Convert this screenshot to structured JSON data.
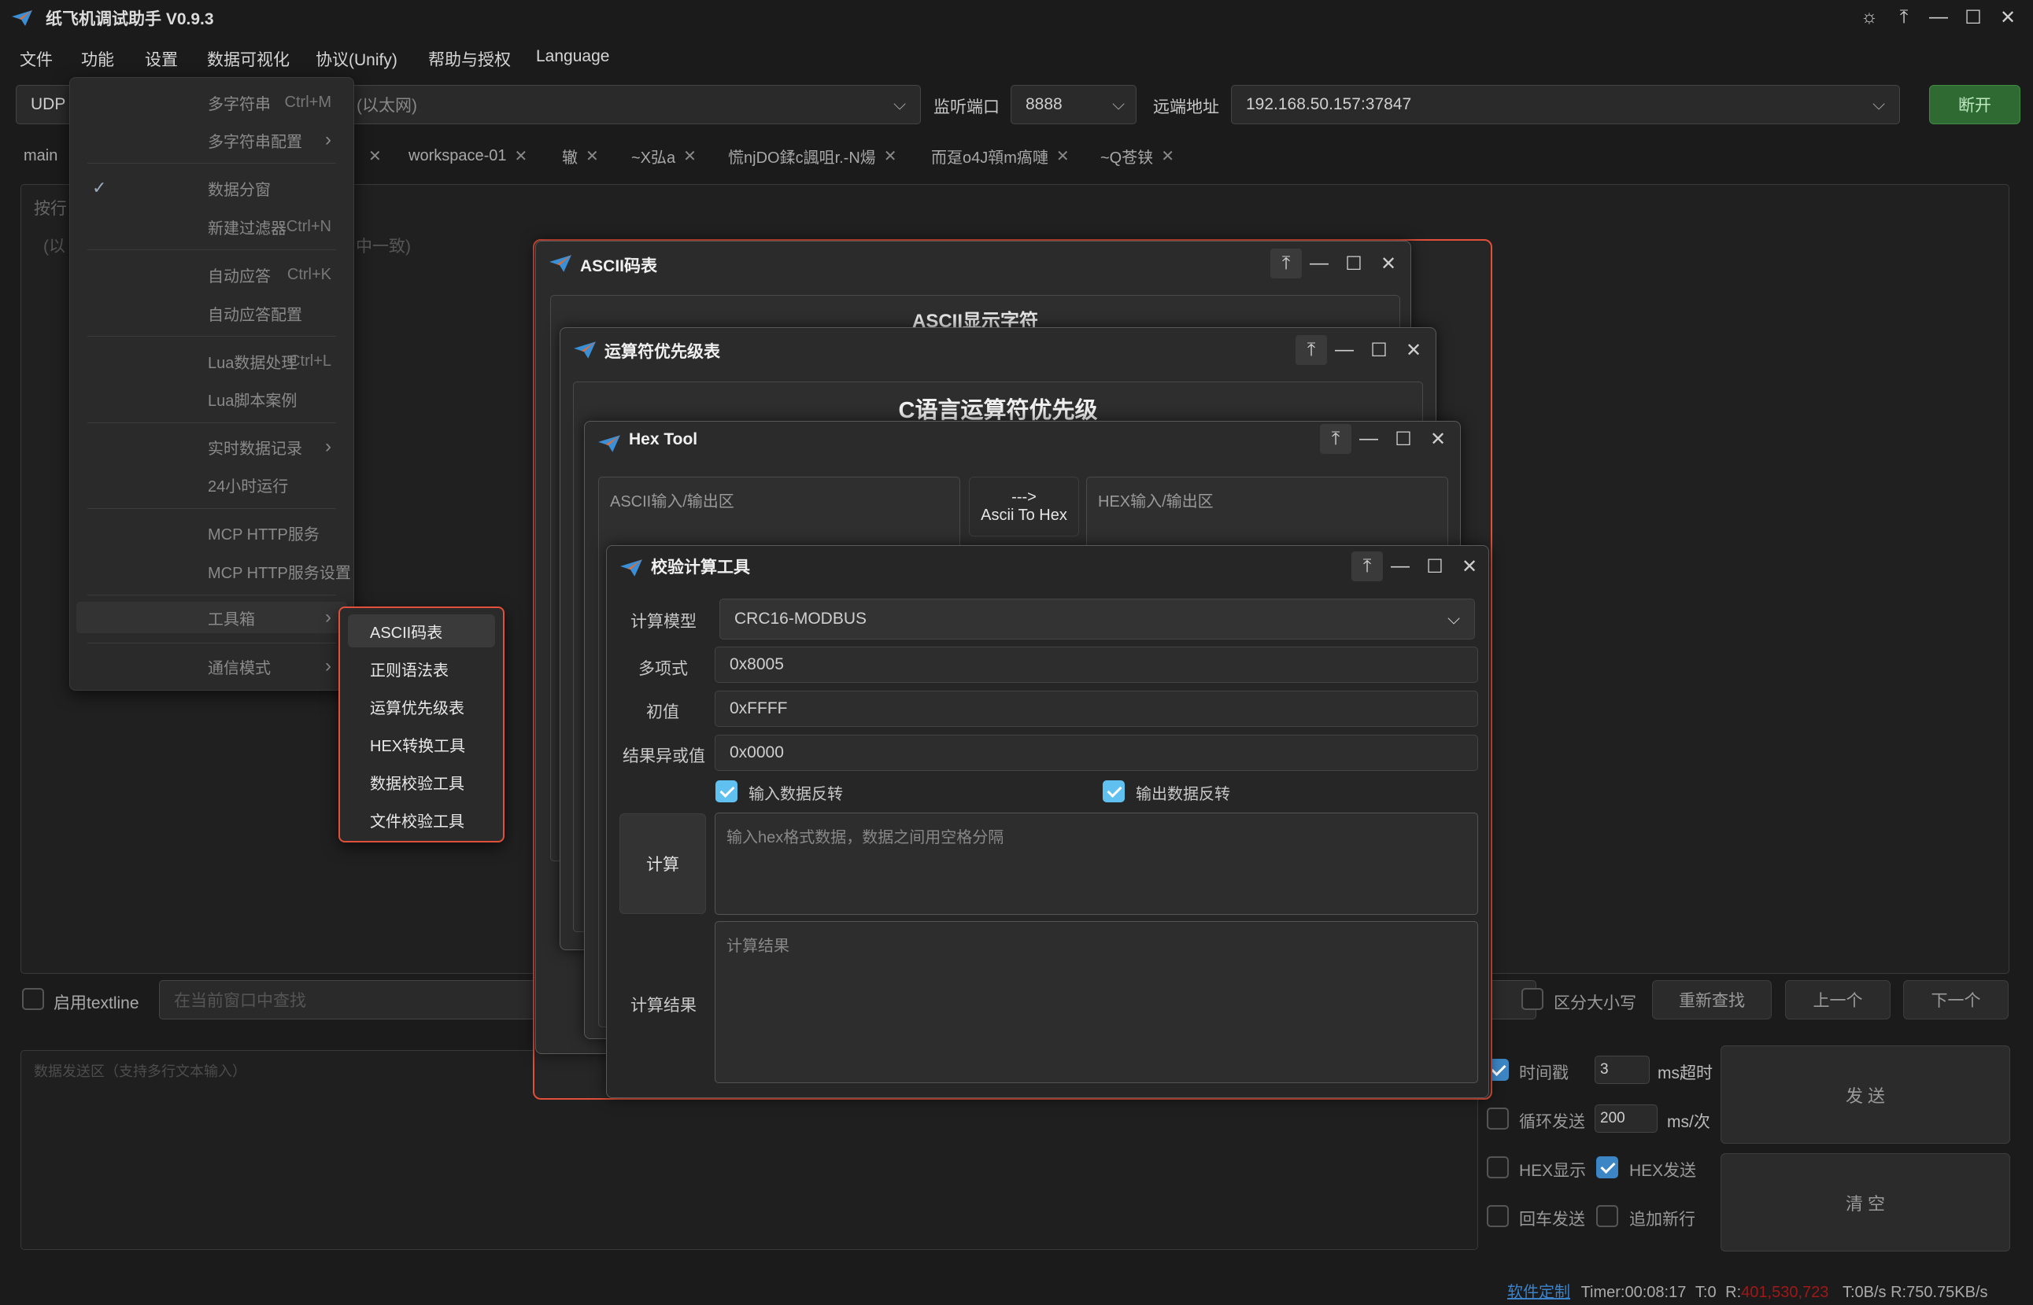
{
  "app": {
    "title": "纸飞机调试助手 V0.9.3"
  },
  "menubar": [
    "文件",
    "功能",
    "设置",
    "数据可视化",
    "协议(Unify)",
    "帮助与授权",
    "Language"
  ],
  "conn": {
    "proto": "UDP",
    "iface_hint": "(以太网)",
    "listen_port_label": "监听端口",
    "listen_port": "8888",
    "remote_label": "远端地址",
    "remote": "192.168.50.157:37847",
    "disconnect": "断开"
  },
  "tabs": [
    "main",
    "workspace-01",
    "辙",
    "~X弘a",
    "慌njDO鍒c諷咀r.-N煬",
    "而趸o4J顇m瘑嗹",
    "~Q苍铗"
  ],
  "main": {
    "hint1": "按行",
    "hint2": "(以",
    "hint3": "中一致)"
  },
  "func_menu": {
    "items": [
      {
        "label": "多字符串",
        "shortcut": "Ctrl+M"
      },
      {
        "label": "多字符串配置",
        "arrow": "›"
      },
      {
        "label": "数据分窗",
        "checked": true
      },
      {
        "label": "新建过滤器",
        "shortcut": "Ctrl+N"
      },
      {
        "label": "自动应答",
        "shortcut": "Ctrl+K"
      },
      {
        "label": "自动应答配置"
      },
      {
        "label": "Lua数据处理",
        "shortcut": "Ctrl+L"
      },
      {
        "label": "Lua脚本案例"
      },
      {
        "label": "实时数据记录",
        "arrow": "›"
      },
      {
        "label": "24小时运行"
      },
      {
        "label": "MCP HTTP服务"
      },
      {
        "label": "MCP HTTP服务设置"
      },
      {
        "label": "工具箱",
        "arrow": "›"
      },
      {
        "label": "通信模式",
        "arrow": "›"
      }
    ]
  },
  "toolbox_menu": [
    "ASCII码表",
    "正则语法表",
    "运算优先级表",
    "HEX转换工具",
    "数据校验工具",
    "文件校验工具"
  ],
  "ascii_win": {
    "title": "ASCII码表",
    "header": "ASCII显示字符"
  },
  "op_win": {
    "title": "运算符优先级表",
    "header": "C语言运算符优先级"
  },
  "hex_win": {
    "title": "Hex Tool",
    "ascii_area": "ASCII输入/输出区",
    "convert_arrow": "--->",
    "convert_label": "Ascii To Hex",
    "hex_area": "HEX输入/输出区"
  },
  "crc_win": {
    "title": "校验计算工具",
    "model_label": "计算模型",
    "model": "CRC16-MODBUS",
    "poly_label": "多项式",
    "poly": "0x8005",
    "init_label": "初值",
    "init": "0xFFFF",
    "xor_label": "结果异或值",
    "xor": "0x0000",
    "refin": "输入数据反转",
    "refout": "输出数据反转",
    "calc": "计算",
    "input_placeholder": "输入hex格式数据，数据之间用空格分隔",
    "result_label": "计算结果",
    "result_placeholder": "计算结果"
  },
  "search": {
    "enable": "启用textline",
    "placeholder": "在当前窗口中查找",
    "case": "区分大小写",
    "refind": "重新查找",
    "prev": "上一个",
    "next": "下一个"
  },
  "send": {
    "placeholder": "数据发送区（支持多行文本输入）",
    "timestamp": "时间戳",
    "timeout": "3",
    "timeout_unit": "ms超时",
    "loop": "循环发送",
    "interval": "200",
    "interval_unit": "ms/次",
    "hex_show": "HEX显示",
    "hex_send": "HEX发送",
    "cr_send": "回车发送",
    "newline": "追加新行",
    "send_btn": "发 送",
    "clear_btn": "清 空"
  },
  "status": {
    "custom": "软件定制",
    "timer": "Timer:00:08:17",
    "t": "T:0",
    "r_label": "R:",
    "r_value": "401,530,723",
    "rate": "T:0B/s R:750.75KB/s"
  }
}
